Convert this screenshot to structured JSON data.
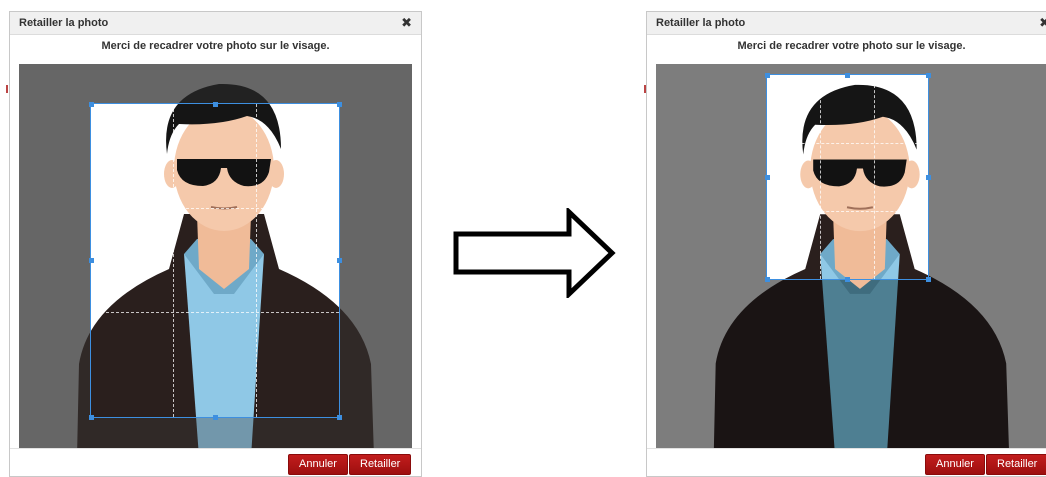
{
  "dialogs": [
    {
      "title": "Retailler la photo",
      "close_glyph": "✖",
      "instruction": "Merci de recadrer votre photo sur le visage.",
      "buttons": {
        "cancel": "Annuler",
        "crop": "Retailler"
      }
    },
    {
      "title": "Retailler la photo",
      "close_glyph": "✖",
      "instruction": "Merci de recadrer votre photo sur le visage.",
      "buttons": {
        "cancel": "Annuler",
        "crop": "Retailler"
      }
    }
  ],
  "transition_icon": "right-arrow-icon",
  "colors": {
    "workspace": "#7d7d7d",
    "crop_border": "#3d8fe0",
    "button_red": "#b01717",
    "jacket": "#2a1f1d",
    "shirt": "#8fc8e6",
    "skin": "#f5c9ab",
    "hair": "#151515"
  }
}
